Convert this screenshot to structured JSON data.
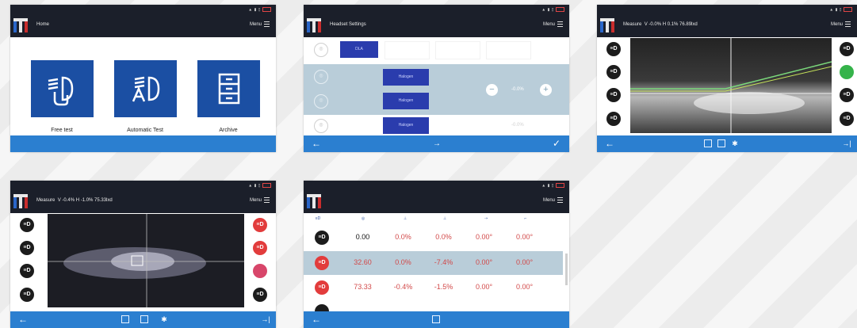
{
  "screens": {
    "home": {
      "title": "Home",
      "menu": "Menu",
      "tiles": [
        {
          "label": "Free test",
          "icon": "hand-headlamp-icon",
          "glyph": "≡D"
        },
        {
          "label": "Automatic Test",
          "icon": "auto-headlamp-icon",
          "glyph": "≣A"
        },
        {
          "label": "Archive",
          "icon": "cabinet-icon",
          "glyph": "☰"
        }
      ]
    },
    "headlamp": {
      "title": "Headset Settings",
      "menu": "Menu",
      "row1_button": "DLA",
      "row2_button": "Halogen",
      "row3_button": "Halogen",
      "row4_button": "Halogen",
      "row2_value": "-0.0%",
      "row4_value": "-0.0%",
      "minus": "−",
      "plus": "+",
      "back": "←",
      "next": "→",
      "ok": "✓"
    },
    "measure1": {
      "title": "Measure",
      "readout": "V -0.0% H 0.1% 76.89lxd",
      "menu": "Menu",
      "back": "←",
      "end": "→|"
    },
    "measure2": {
      "title": "Measure",
      "readout": "V -0.4% H -1.0% 75.33lxd",
      "menu": "Menu",
      "back": "←",
      "end": "→|"
    },
    "results": {
      "menu": "Menu",
      "back": "←",
      "rows": [
        {
          "lamp": "black",
          "values": [
            "0.00",
            "0.0%",
            "0.0%",
            "0.00°",
            "0.00°"
          ],
          "color": "#111111"
        },
        {
          "lamp": "red",
          "values": [
            "32.60",
            "0.0%",
            "-7.4%",
            "0.00°",
            "0.00°"
          ],
          "color": "#d24848"
        },
        {
          "lamp": "red",
          "values": [
            "73.33",
            "-0.4%",
            "-1.5%",
            "0.00°",
            "0.00°"
          ],
          "color": "#d24848"
        }
      ]
    }
  },
  "colors": {
    "topbar": "#1b1f2a",
    "bottombar": "#2b7fd0",
    "tile": "#1b4fa3",
    "selected_button": "#2a3cad",
    "green": "#35b34a",
    "red": "#e23c3c"
  }
}
